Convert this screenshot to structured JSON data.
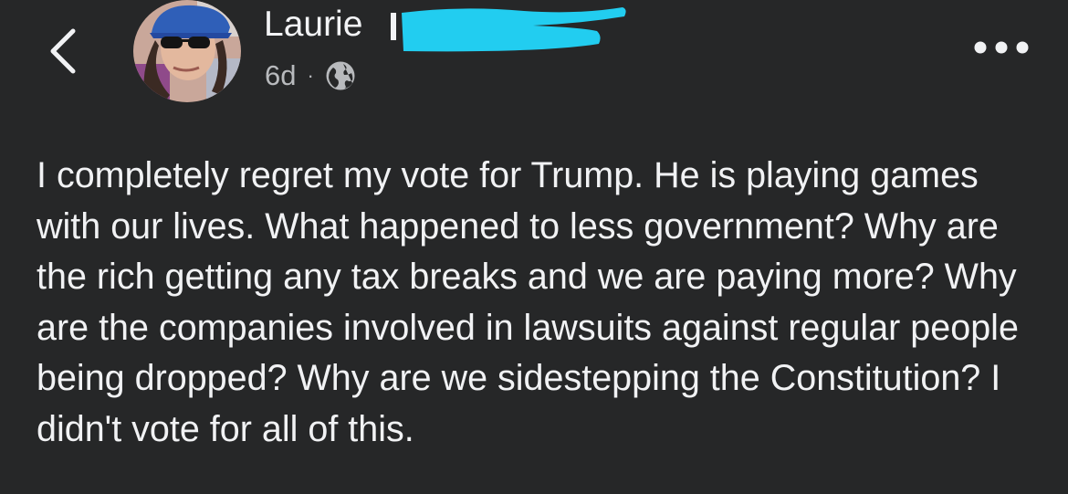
{
  "post": {
    "author_name": "Laurie",
    "timestamp": "6d",
    "separator": "·",
    "privacy_icon": "globe-icon",
    "text": "I completely regret my vote for Trump. He is playing games with our lives. What happened to less government? Why are the rich getting any tax breaks and we are paying more? Why are the companies involved in lawsuits against regular people being dropped? Why are we sidestepping the Constitution? I didn't vote for all of this."
  },
  "icons": {
    "back": "chevron-left-icon",
    "more": "more-horizontal-icon"
  },
  "colors": {
    "background": "#262728",
    "text": "#f1f2f4",
    "secondary_text": "#b8babd",
    "redaction": "#22cdf0"
  }
}
